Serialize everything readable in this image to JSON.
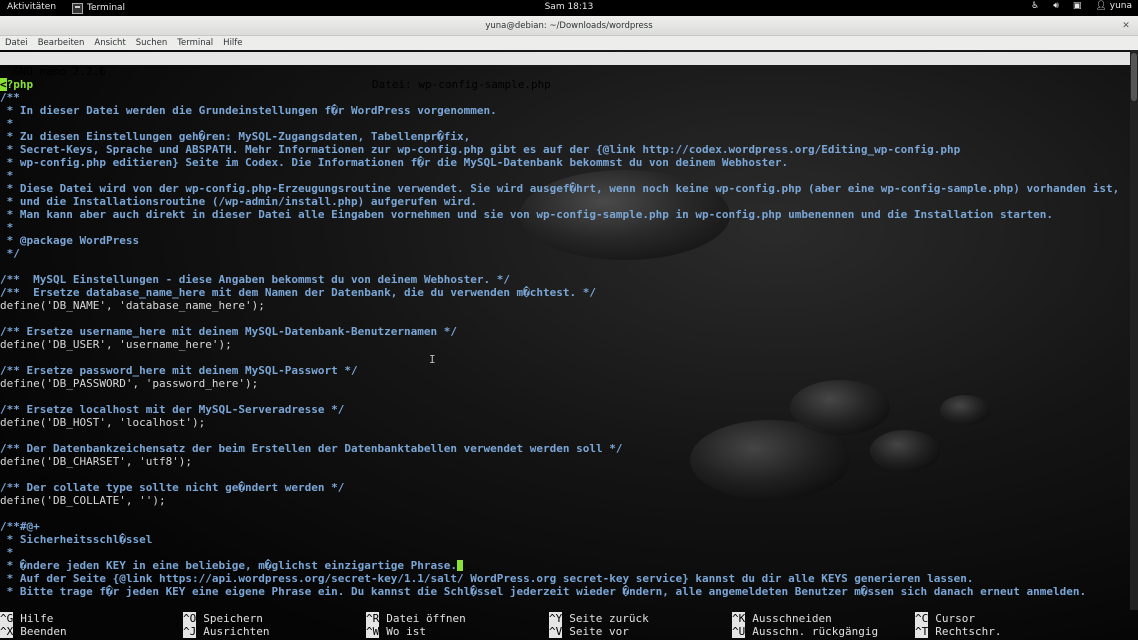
{
  "topbar": {
    "activities": "Aktivitäten",
    "app_name": "Terminal",
    "clock": "Sam 18:13",
    "user": "yuna",
    "tray_icons": [
      "accessibility-icon",
      "volume-icon",
      "network-icon",
      "user-icon"
    ]
  },
  "window": {
    "title": "yuna@debian: ~/Downloads/wordpress",
    "close": "✕",
    "menu": [
      "Datei",
      "Bearbeiten",
      "Ansicht",
      "Suchen",
      "Terminal",
      "Hilfe"
    ]
  },
  "nano": {
    "version": "GNU nano 2.2.6",
    "file": "Datei: wp-config-sample.php",
    "lines": [
      {
        "cls": "php",
        "t": "<?php"
      },
      {
        "cls": "c",
        "t": "/**"
      },
      {
        "cls": "c",
        "t": " * In dieser Datei werden die Grundeinstellungen f�r WordPress vorgenommen."
      },
      {
        "cls": "c",
        "t": " *"
      },
      {
        "cls": "c",
        "t": " * Zu diesen Einstellungen geh�ren: MySQL-Zugangsdaten, Tabellenpr�fix,"
      },
      {
        "cls": "c",
        "t": " * Secret-Keys, Sprache und ABSPATH. Mehr Informationen zur wp-config.php gibt es auf der {@link http://codex.wordpress.org/Editing_wp-config.php"
      },
      {
        "cls": "c",
        "t": " * wp-config.php editieren} Seite im Codex. Die Informationen f�r die MySQL-Datenbank bekommst du von deinem Webhoster."
      },
      {
        "cls": "c",
        "t": " *"
      },
      {
        "cls": "c",
        "t": " * Diese Datei wird von der wp-config.php-Erzeugungsroutine verwendet. Sie wird ausgef�hrt, wenn noch keine wp-config.php (aber eine wp-config-sample.php) vorhanden ist,"
      },
      {
        "cls": "c",
        "t": " * und die Installationsroutine (/wp-admin/install.php) aufgerufen wird."
      },
      {
        "cls": "c",
        "t": " * Man kann aber auch direkt in dieser Datei alle Eingaben vornehmen und sie von wp-config-sample.php in wp-config.php umbenennen und die Installation starten."
      },
      {
        "cls": "c",
        "t": " *"
      },
      {
        "cls": "c",
        "t": " * @package WordPress"
      },
      {
        "cls": "c",
        "t": " */"
      },
      {
        "cls": "d",
        "t": ""
      },
      {
        "cls": "c",
        "t": "/**  MySQL Einstellungen - diese Angaben bekommst du von deinem Webhoster. */"
      },
      {
        "cls": "c",
        "t": "/**  Ersetze database_name_here mit dem Namen der Datenbank, die du verwenden m�chtest. */"
      },
      {
        "cls": "d",
        "t": "define('DB_NAME', 'database_name_here');"
      },
      {
        "cls": "d",
        "t": ""
      },
      {
        "cls": "c",
        "t": "/** Ersetze username_here mit deinem MySQL-Datenbank-Benutzernamen */"
      },
      {
        "cls": "d",
        "t": "define('DB_USER', 'username_here');"
      },
      {
        "cls": "d",
        "t": ""
      },
      {
        "cls": "c",
        "t": "/** Ersetze password_here mit deinem MySQL-Passwort */"
      },
      {
        "cls": "d",
        "t": "define('DB_PASSWORD', 'password_here');"
      },
      {
        "cls": "d",
        "t": ""
      },
      {
        "cls": "c",
        "t": "/** Ersetze localhost mit der MySQL-Serveradresse */"
      },
      {
        "cls": "d",
        "t": "define('DB_HOST', 'localhost');"
      },
      {
        "cls": "d",
        "t": ""
      },
      {
        "cls": "c",
        "t": "/** Der Datenbankzeichensatz der beim Erstellen der Datenbanktabellen verwendet werden soll */"
      },
      {
        "cls": "d",
        "t": "define('DB_CHARSET', 'utf8');"
      },
      {
        "cls": "d",
        "t": ""
      },
      {
        "cls": "c",
        "t": "/** Der collate type sollte nicht ge�ndert werden */"
      },
      {
        "cls": "d",
        "t": "define('DB_COLLATE', '');"
      },
      {
        "cls": "d",
        "t": ""
      },
      {
        "cls": "c",
        "t": "/**#@+"
      },
      {
        "cls": "c",
        "t": " * Sicherheitsschl�ssel"
      },
      {
        "cls": "c",
        "t": " *"
      },
      {
        "cls": "c",
        "t": " * �ndere jeden KEY in eine beliebige, m�glichst einzigartige Phrase."
      },
      {
        "cls": "c",
        "t": " * Auf der Seite {@link https://api.wordpress.org/secret-key/1.1/salt/ WordPress.org secret-key service} kannst du dir alle KEYS generieren lassen."
      },
      {
        "cls": "c",
        "t": " * Bitte trage f�r jeden KEY eine eigene Phrase ein. Du kannst die Schl�ssel jederzeit wieder �ndern, alle angemeldeten Benutzer m�ssen sich danach erneut anmelden."
      }
    ],
    "shortcuts": [
      [
        {
          "key": "^G",
          "label": "Hilfe"
        },
        {
          "key": "^X",
          "label": "Beenden"
        }
      ],
      [
        {
          "key": "^O",
          "label": "Speichern"
        },
        {
          "key": "^J",
          "label": "Ausrichten"
        }
      ],
      [
        {
          "key": "^R",
          "label": "Datei öffnen"
        },
        {
          "key": "^W",
          "label": "Wo ist"
        }
      ],
      [
        {
          "key": "^Y",
          "label": "Seite zurück"
        },
        {
          "key": "^V",
          "label": "Seite vor"
        }
      ],
      [
        {
          "key": "^K",
          "label": "Ausschneiden"
        },
        {
          "key": "^U",
          "label": "Ausschn. rückgängig"
        }
      ],
      [
        {
          "key": "^C",
          "label": "Cursor"
        },
        {
          "key": "^T",
          "label": "Rechtschr."
        }
      ]
    ]
  }
}
